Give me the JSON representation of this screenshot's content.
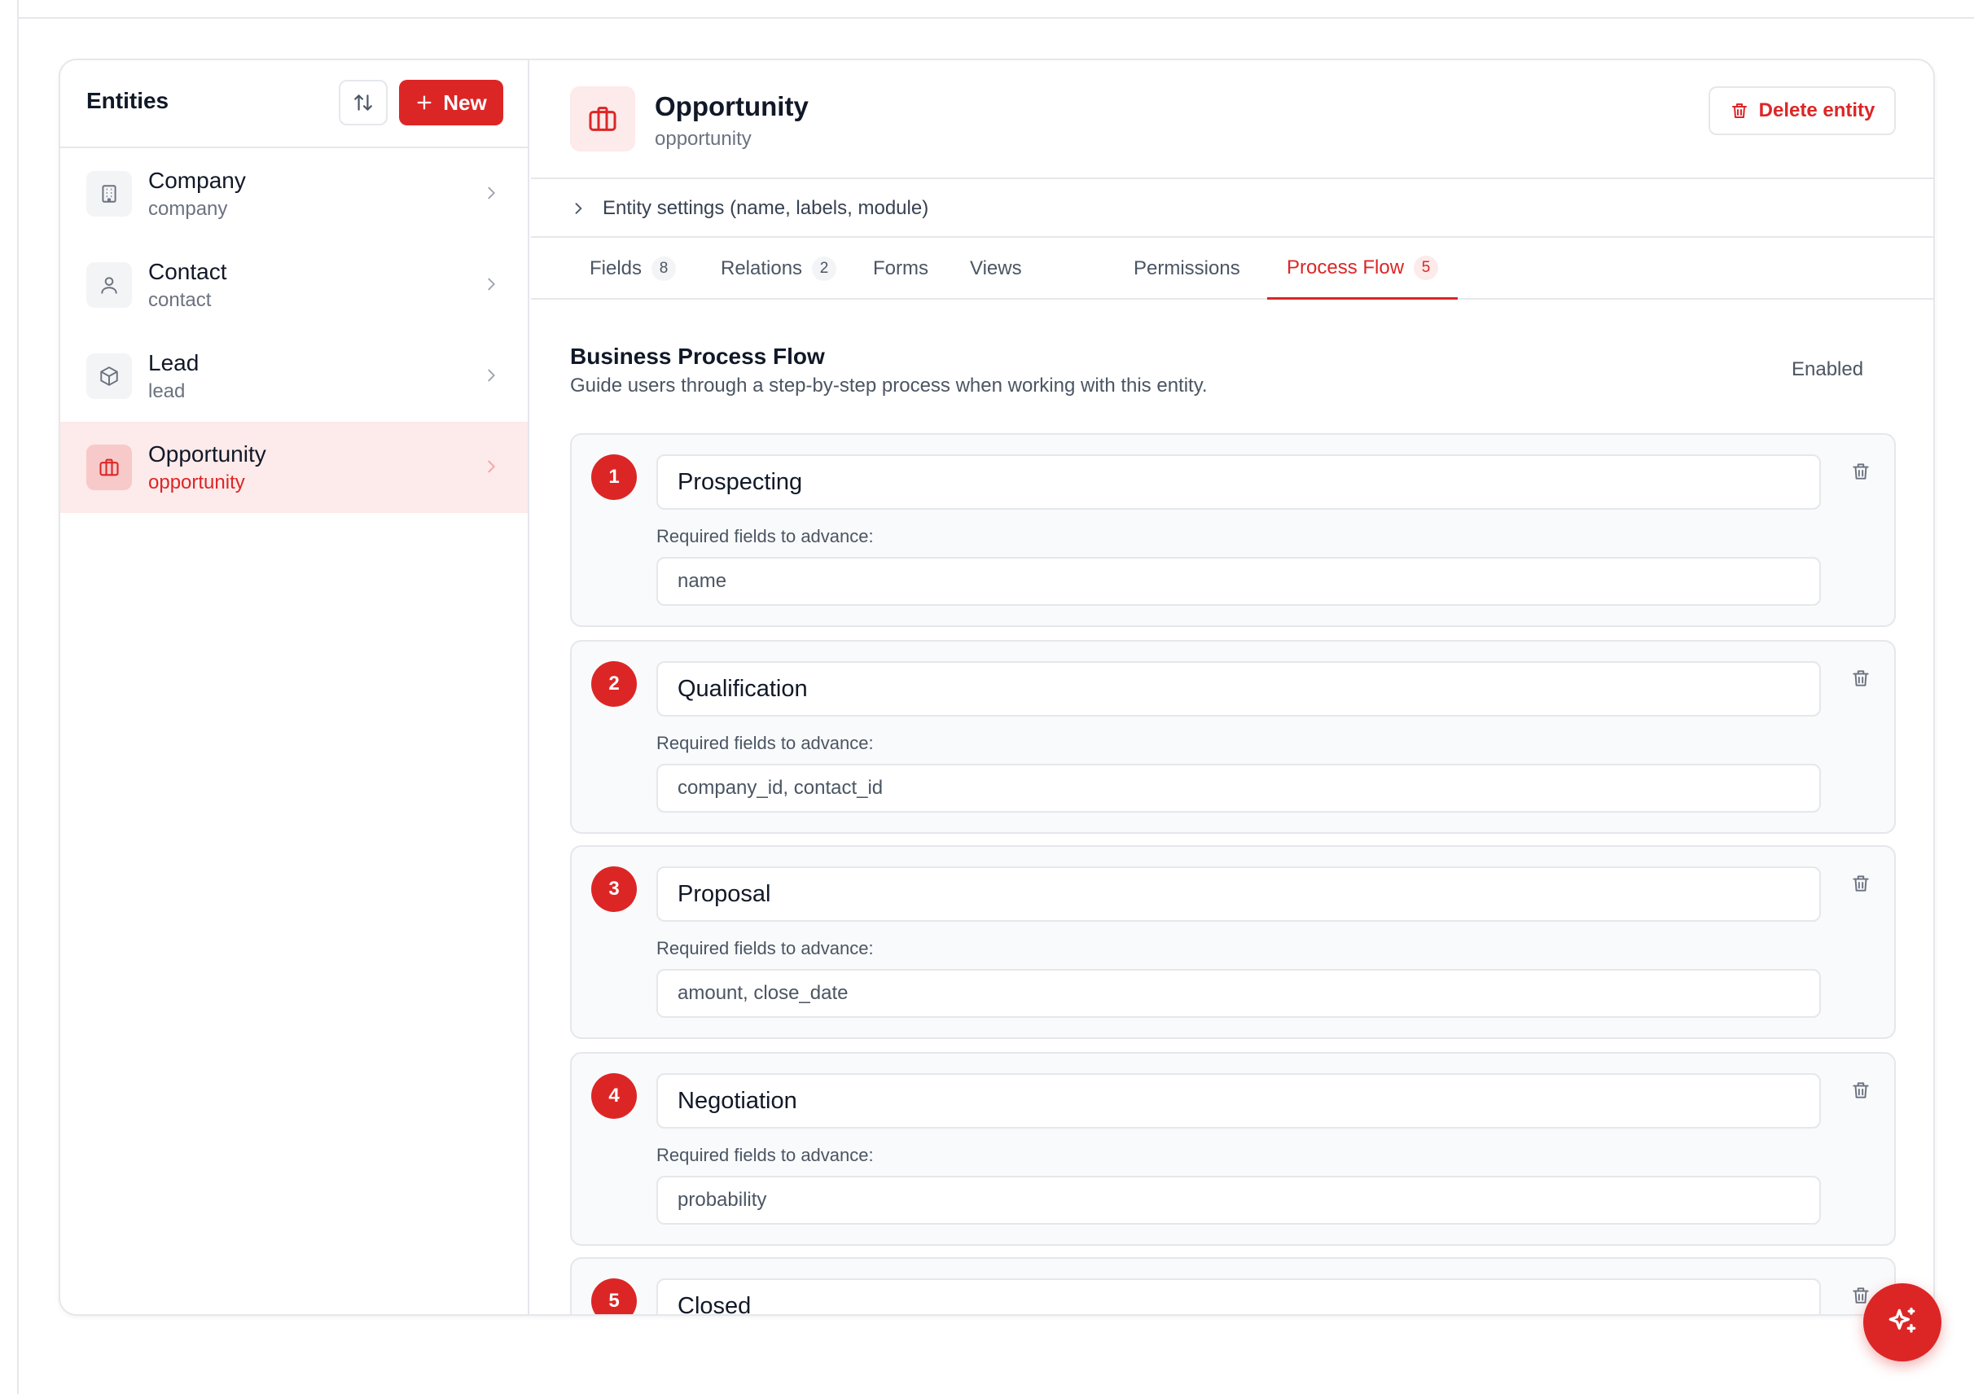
{
  "sidebar": {
    "title": "Entities",
    "new_label": "New",
    "items": [
      {
        "label": "Company",
        "sub": "company",
        "icon": "building-icon"
      },
      {
        "label": "Contact",
        "sub": "contact",
        "icon": "user-icon"
      },
      {
        "label": "Lead",
        "sub": "lead",
        "icon": "box-icon"
      },
      {
        "label": "Opportunity",
        "sub": "opportunity",
        "icon": "briefcase-icon",
        "active": true
      }
    ]
  },
  "entity": {
    "title": "Opportunity",
    "subtitle": "opportunity",
    "delete_label": "Delete entity",
    "settings_label": "Entity settings (name, labels, module)"
  },
  "tabs": [
    {
      "label": "Fields",
      "badge": "8"
    },
    {
      "label": "Relations",
      "badge": "2"
    },
    {
      "label": "Forms"
    },
    {
      "label": "Views"
    },
    {
      "label": "Permissions"
    },
    {
      "label": "Process Flow",
      "badge": "5",
      "active": true
    }
  ],
  "bpf": {
    "title": "Business Process Flow",
    "description": "Guide users through a step-by-step process when working with this entity.",
    "enabled_label": "Enabled",
    "enabled": true,
    "required_label": "Required fields to advance:",
    "stages": [
      {
        "num": "1",
        "name": "Prospecting",
        "required": "name"
      },
      {
        "num": "2",
        "name": "Qualification",
        "required": "company_id, contact_id"
      },
      {
        "num": "3",
        "name": "Proposal",
        "required": "amount, close_date"
      },
      {
        "num": "4",
        "name": "Negotiation",
        "required": "probability"
      },
      {
        "num": "5",
        "name": "Closed",
        "required": ""
      }
    ]
  },
  "colors": {
    "accent": "#dc2626",
    "checkbox": "#2563eb"
  }
}
